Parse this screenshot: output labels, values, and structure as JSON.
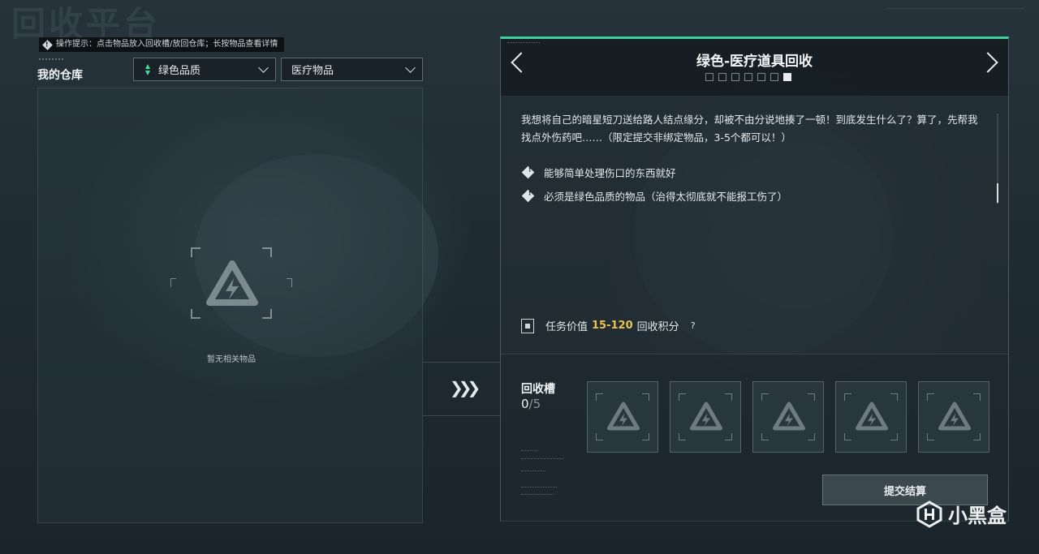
{
  "background_title": "回收平台",
  "tip": {
    "icon": "info-diamond-icon",
    "text": "操作提示：点击物品放入回收槽/放回仓库；长按物品查看详情"
  },
  "warehouse": {
    "title": "我的仓库",
    "quality_filter": "绿色品质",
    "category_filter": "医疗物品",
    "empty_text": "暂无相关物品"
  },
  "quest": {
    "title": "绿色-医疗道具回收",
    "pages_total": 7,
    "current_page": 7,
    "description": "我想将自己的暗星短刀送给路人结点缘分，却被不由分说地揍了一顿！到底发生什么了？算了，先帮我找点外伤药吧……（限定提交非绑定物品，3-5个都可以！）",
    "requirements": [
      "能够简单处理伤口的东西就好",
      "必须是绿色品质的物品（治得太彻底就不能报工伤了）"
    ],
    "reward": {
      "prefix": "任务价值",
      "range": "15-120",
      "suffix": "回收积分",
      "help": "?"
    },
    "slots": {
      "label": "回收槽",
      "filled": "0",
      "max": "/5"
    },
    "submit_label": "提交结算"
  },
  "colors": {
    "accent": "#3fcf9f",
    "reward_highlight": "#e9c34d",
    "quality_green": "#3ddc9a"
  },
  "watermark": {
    "text": "小黑盒"
  }
}
